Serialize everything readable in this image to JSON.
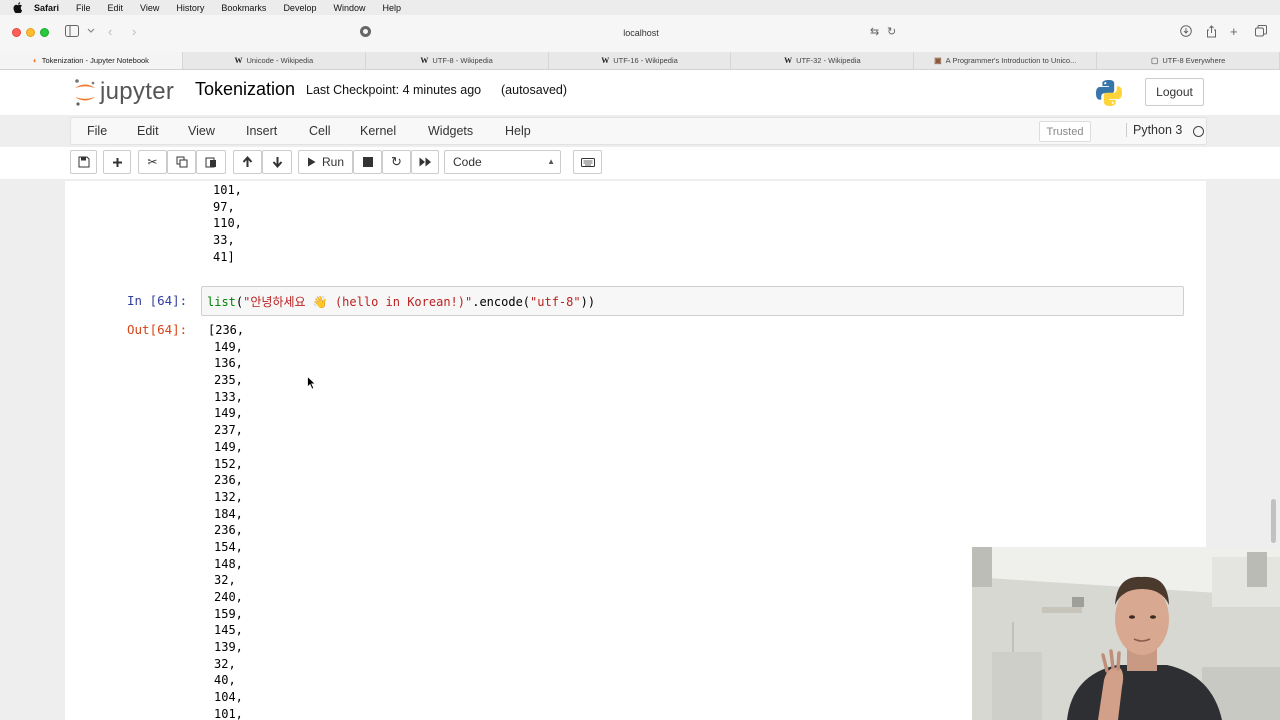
{
  "menubar": {
    "app": "Safari",
    "items": [
      "File",
      "Edit",
      "View",
      "History",
      "Bookmarks",
      "Develop",
      "Window",
      "Help"
    ]
  },
  "browser": {
    "url": "localhost",
    "tabs": [
      {
        "label": "Tokenization - Jupyter Notebook",
        "favicon": "jupyter-icon",
        "active": true
      },
      {
        "label": "Unicode - Wikipedia",
        "favicon": "W",
        "active": false
      },
      {
        "label": "UTF-8 - Wikipedia",
        "favicon": "W",
        "active": false
      },
      {
        "label": "UTF-16 - Wikipedia",
        "favicon": "W",
        "active": false
      },
      {
        "label": "UTF-32 - Wikipedia",
        "favicon": "W",
        "active": false
      },
      {
        "label": "A Programmer's Introduction to Unico...",
        "favicon": "page-icon",
        "active": false
      },
      {
        "label": "UTF-8 Everywhere",
        "favicon": "page-icon",
        "active": false
      }
    ]
  },
  "jupyter": {
    "logo_text": "jupyter",
    "notebook_title": "Tokenization",
    "checkpoint": "Last Checkpoint: 4 minutes ago",
    "autosave": "(autosaved)",
    "logout": "Logout",
    "menu": [
      "File",
      "Edit",
      "View",
      "Insert",
      "Cell",
      "Kernel",
      "Widgets",
      "Help"
    ],
    "trusted": "Trusted",
    "kernel": "Python 3",
    "toolbar": {
      "run_label": "Run",
      "cell_type": "Code"
    }
  },
  "notebook": {
    "previous_output_tail": [
      "101,",
      "97,",
      "110,",
      "33,",
      "41]"
    ],
    "cell": {
      "in_prompt": "In [64]:",
      "code_fn": "list",
      "code_open": "(",
      "code_str": "\"안녕하세요 👋 (hello in Korean!)\"",
      "code_method": ".encode(",
      "code_arg": "\"utf-8\"",
      "code_close": "))",
      "out_prompt": "Out[64]:",
      "output": [
        "[236,",
        "149,",
        "136,",
        "235,",
        "133,",
        "149,",
        "237,",
        "149,",
        "152,",
        "236,",
        "132,",
        "184,",
        "236,",
        "154,",
        "148,",
        "32,",
        "240,",
        "159,",
        "145,",
        "139,",
        "32,",
        "40,",
        "104,",
        "101,"
      ]
    }
  }
}
